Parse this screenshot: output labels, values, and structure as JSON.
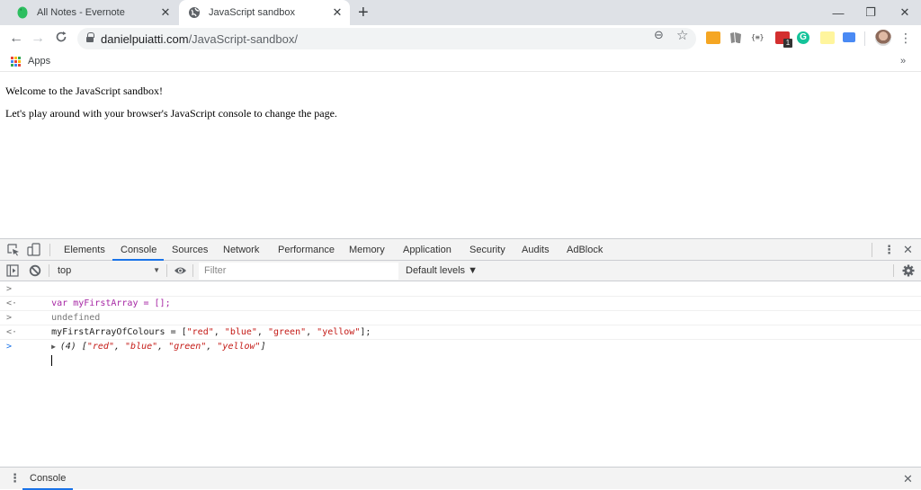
{
  "browser": {
    "tabs": [
      {
        "title": "All Notes - Evernote",
        "icon": "evernote-icon",
        "active": false
      },
      {
        "title": "JavaScript sandbox",
        "icon": "globe-icon",
        "active": true
      }
    ],
    "new_tab": "+",
    "window_controls": {
      "minimize": "—",
      "restore": "❐",
      "close": "✕"
    },
    "nav": {
      "back": "←",
      "forward": "→",
      "reload": "C"
    },
    "url": {
      "domain": "danielpuiatti.com",
      "path": "/JavaScript-sandbox/"
    },
    "omnibox_icons": {
      "zoom": "⊖",
      "bookmark": "☆"
    },
    "extensions": [
      {
        "name": "extension-orange-icon",
        "color": "#f5a623"
      },
      {
        "name": "extension-book-icon",
        "color": "#8a8a8a"
      },
      {
        "name": "extension-json-icon",
        "color": "#444444",
        "label": "{≡}"
      },
      {
        "name": "extension-lastpass-icon",
        "color": "#d32f2f",
        "badge": "1"
      },
      {
        "name": "grammarly-icon",
        "color": "#15c39a",
        "label": "G"
      },
      {
        "name": "extension-sticky-note-icon",
        "color": "#fff59d"
      },
      {
        "name": "extension-blue-tag-icon",
        "color": "#4a8af4"
      }
    ],
    "menu": "⋮",
    "bookmarks": {
      "apps_label": "Apps",
      "more": "»"
    }
  },
  "page": {
    "lines": [
      "Welcome to the JavaScript sandbox!",
      "Let's play around with your browser's JavaScript console to change the page."
    ]
  },
  "devtools": {
    "tabs": [
      "Elements",
      "Console",
      "Sources",
      "Network",
      "Performance",
      "Memory",
      "Application",
      "Security",
      "Audits",
      "AdBlock"
    ],
    "active_tab": "Console",
    "context": "top",
    "filter_placeholder": "Filter",
    "levels": "Default levels ▼",
    "console": [
      {
        "type": "input",
        "parts": [
          {
            "t": "var ",
            "c": "kw"
          },
          {
            "t": "myFirstArray = [];",
            "c": "kw"
          }
        ]
      },
      {
        "type": "output",
        "parts": [
          {
            "t": "undefined",
            "c": "muted"
          }
        ]
      },
      {
        "type": "input",
        "parts": [
          {
            "t": "myFirstArrayOfColours = [",
            "c": "plain"
          },
          {
            "t": "\"red\"",
            "c": "str"
          },
          {
            "t": ", ",
            "c": "plain"
          },
          {
            "t": "\"blue\"",
            "c": "str"
          },
          {
            "t": ", ",
            "c": "plain"
          },
          {
            "t": "\"green\"",
            "c": "str"
          },
          {
            "t": ", ",
            "c": "plain"
          },
          {
            "t": "\"yellow\"",
            "c": "str"
          },
          {
            "t": "];",
            "c": "plain"
          }
        ]
      },
      {
        "type": "result",
        "parts": [
          {
            "t": "(4) [",
            "c": "plain italic"
          },
          {
            "t": "\"red\"",
            "c": "str italic"
          },
          {
            "t": ", ",
            "c": "plain italic"
          },
          {
            "t": "\"blue\"",
            "c": "str italic"
          },
          {
            "t": ", ",
            "c": "plain italic"
          },
          {
            "t": "\"green\"",
            "c": "str italic"
          },
          {
            "t": ", ",
            "c": "plain italic"
          },
          {
            "t": "\"yellow\"",
            "c": "str italic"
          },
          {
            "t": "]",
            "c": "plain italic"
          }
        ]
      }
    ],
    "drawer_tab": "Console"
  }
}
